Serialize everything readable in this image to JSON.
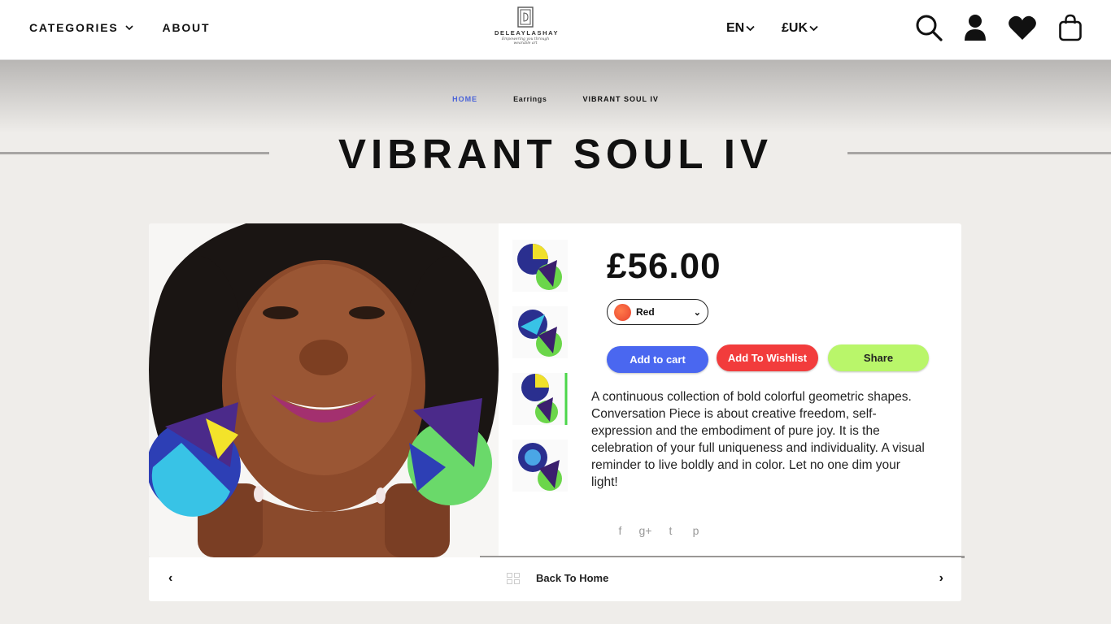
{
  "header": {
    "nav": {
      "categories": "CATEGORIES",
      "about": "ABOUT"
    },
    "logo": {
      "name": "DELEAYLASHAY",
      "tagline": "Empowering you through wearable art"
    },
    "language": "EN",
    "currency": "£UK",
    "icons": [
      "search-icon",
      "user-icon",
      "heart-icon",
      "shopping-bag-icon"
    ]
  },
  "breadcrumb": {
    "home": "HOME",
    "category": "Earrings",
    "current": "VIBRANT SOUL IV"
  },
  "page_title": "VIBRANT SOUL IV",
  "product": {
    "price": "£56.00",
    "variant": {
      "selected": "Red",
      "swatch_color": "#e8432f"
    },
    "buttons": {
      "add_to_cart": "Add to cart",
      "add_to_wishlist": "Add To Wishlist",
      "share": "Share"
    },
    "description": "A continuous collection of bold colorful geometric shapes. Conversation Piece is about creative freedom, self-expression and the embodiment of pure joy. It is the celebration of your full uniqueness and individuality. A visual reminder to live boldly and in color. Let no one dim your light!",
    "social": [
      "f",
      "g+",
      "t",
      "p"
    ]
  },
  "bottom_nav": {
    "back": "Back To Home",
    "prev": "‹",
    "next": "›"
  },
  "colors": {
    "accent_blue": "#4a67f0",
    "wishlist_red": "#f23c3c",
    "share_green": "#b9f66a",
    "home_link": "#4a63d8",
    "background": "#efedea"
  }
}
